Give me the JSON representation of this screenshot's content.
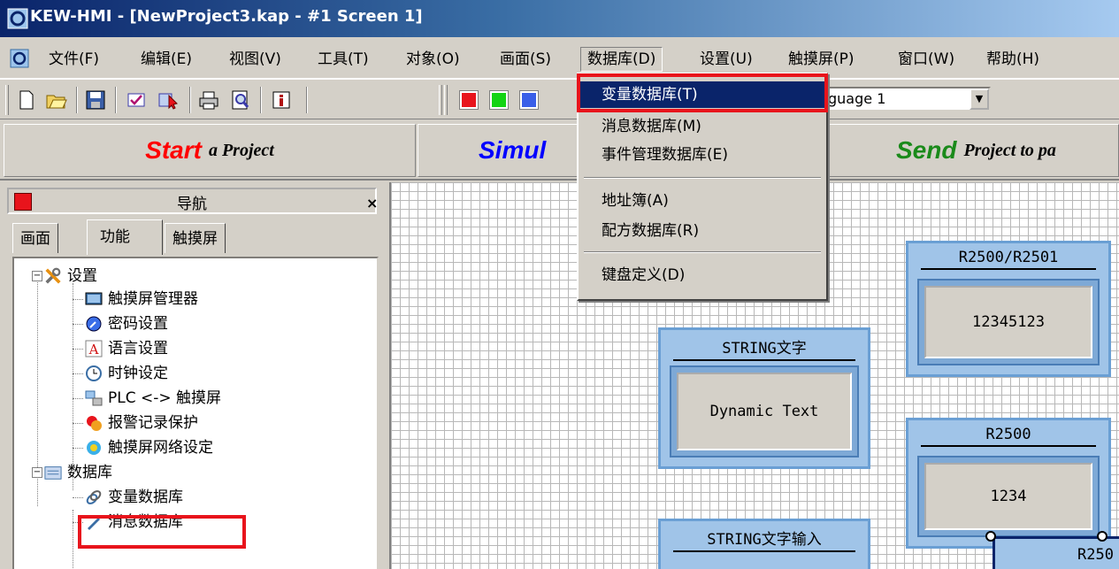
{
  "window": {
    "title": "KEW-HMI - [NewProject3.kap - #1 Screen 1]"
  },
  "menubar": {
    "items": [
      "文件(F)",
      "编辑(E)",
      "视图(V)",
      "工具(T)",
      "对象(O)",
      "画面(S)",
      "数据库(D)",
      "设置(U)",
      "触摸屏(P)",
      "窗口(W)",
      "帮助(H)"
    ],
    "active": "数据库(D)"
  },
  "toolbar": {
    "language_value": "guage 1"
  },
  "projectbar": {
    "start_big": "Start",
    "start_small": "a Project",
    "simulate_big": "Simul",
    "send_big": "Send",
    "send_small": "Project to pa",
    "colors": {
      "start": "#ff0000",
      "simulate": "#0000ff",
      "send": "#1a8a1a"
    }
  },
  "database_menu": {
    "items": [
      {
        "label": "变量数据库(T)",
        "selected": true
      },
      {
        "label": "消息数据库(M)"
      },
      {
        "label": "事件管理数据库(E)"
      },
      {
        "label": "地址簿(A)"
      },
      {
        "label": "配方数据库(R)"
      },
      {
        "label": "键盘定义(D)"
      }
    ]
  },
  "nav": {
    "title": "导航",
    "close": "×",
    "tabs": [
      "画面",
      "功能",
      "触摸屏"
    ],
    "active_tab": "功能",
    "tree": {
      "settings_group": "设置",
      "settings_items": [
        "触摸屏管理器",
        "密码设置",
        "语言设置",
        "时钟设定",
        "PLC <-> 触摸屏",
        "报警记录保护",
        "触摸屏网络设定"
      ],
      "database_group": "数据库",
      "database_items": [
        "变量数据库",
        "消息数据库"
      ]
    }
  },
  "canvas": {
    "widgets": [
      {
        "title": "R2500/R2501",
        "value": "12345123"
      },
      {
        "title": "STRING文字",
        "value": "Dynamic Text"
      },
      {
        "title": "R2500",
        "value": "1234"
      },
      {
        "title": "STRING文字输入",
        "value": ""
      },
      {
        "title": "",
        "value": "R250"
      }
    ]
  },
  "accent_colors": {
    "highlight": "#e8141c",
    "menu_selection": "#0a246a"
  }
}
